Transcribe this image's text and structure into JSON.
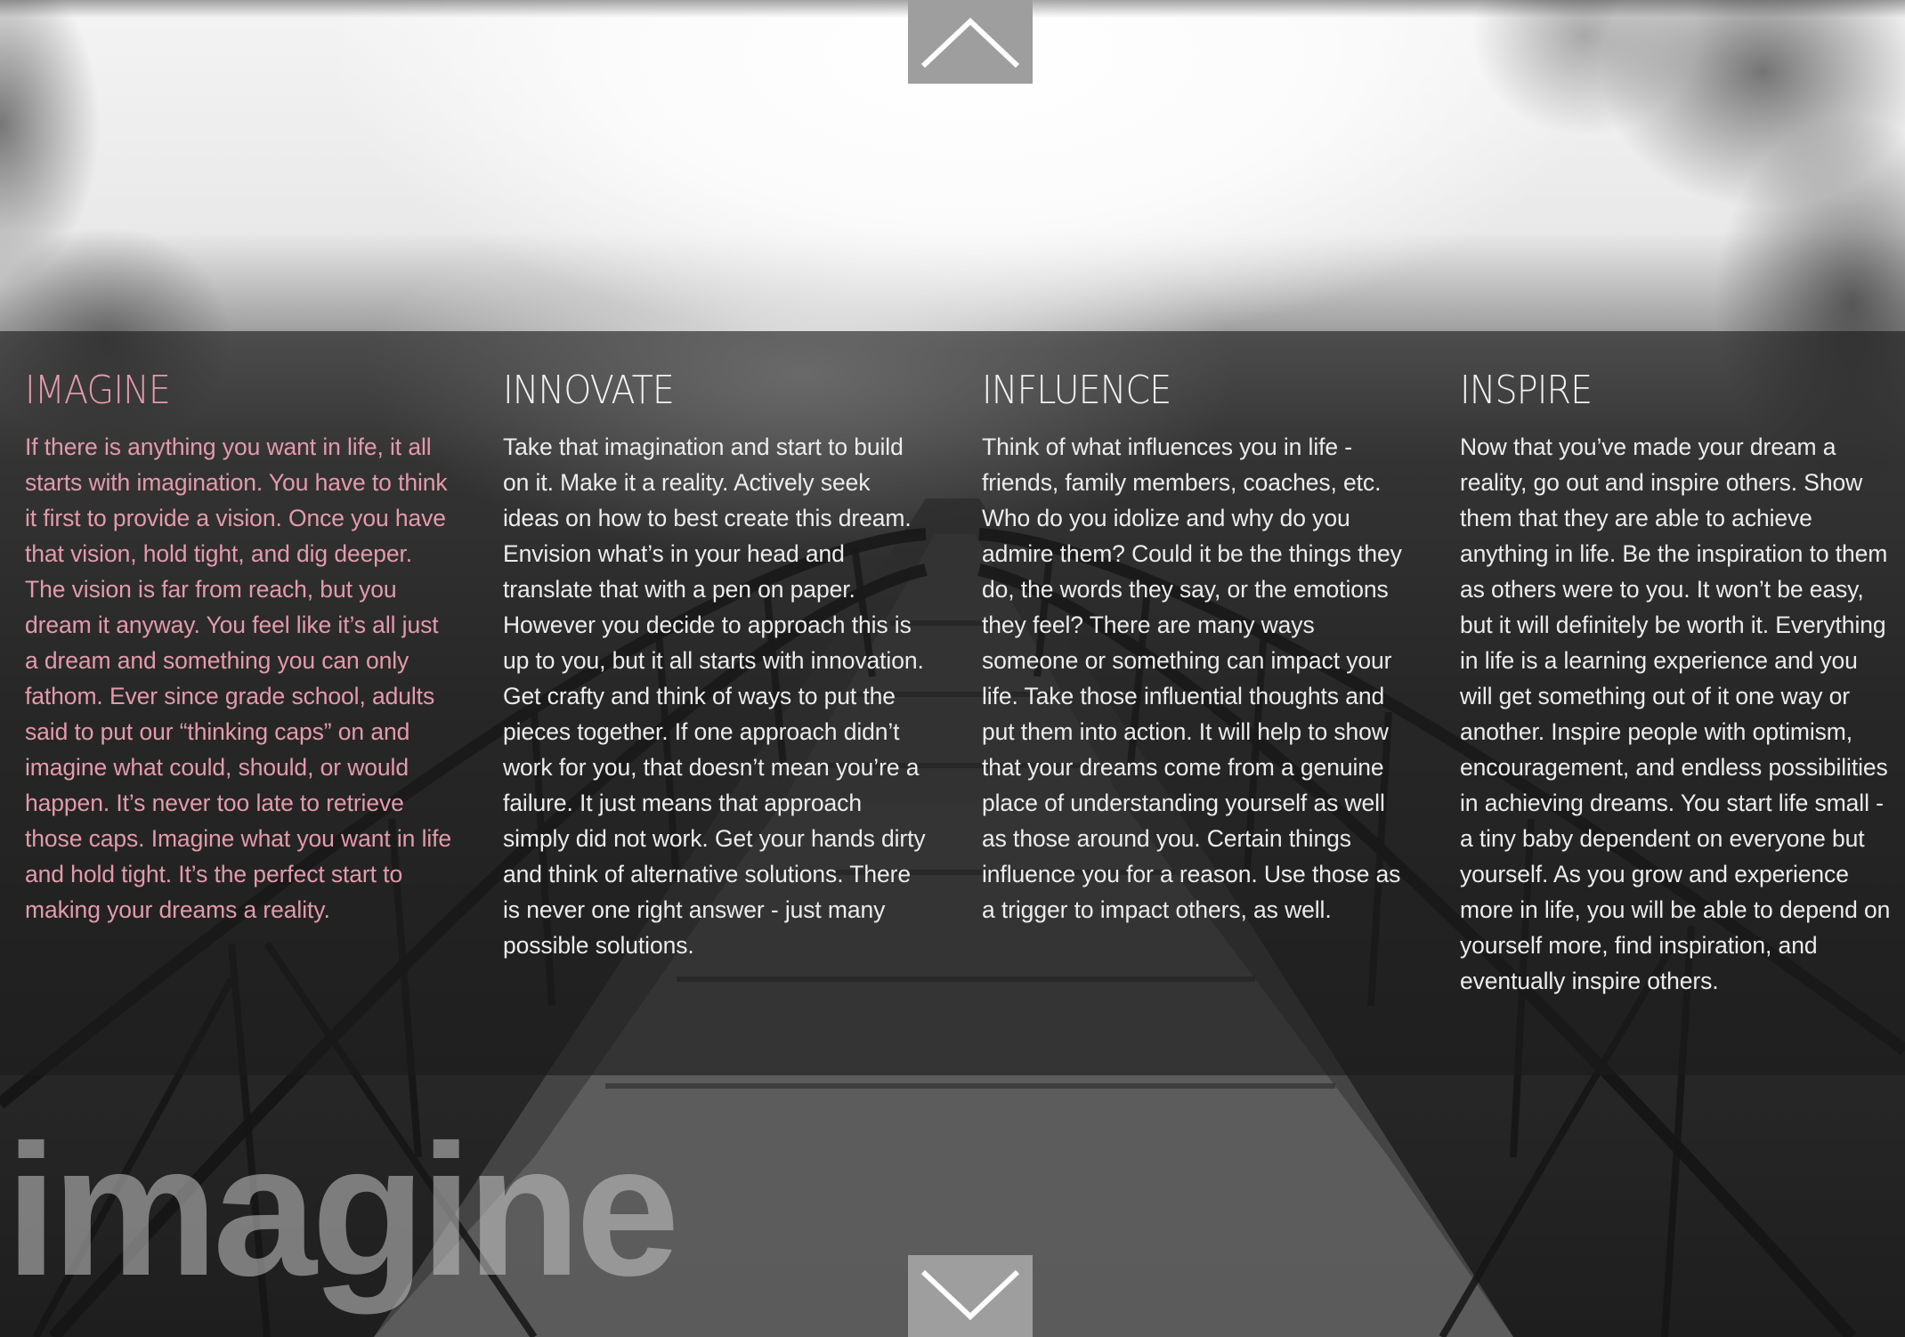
{
  "sections": [
    {
      "heading": "IMAGINE",
      "body": "If there is anything you want in life, it all starts with imagination. You have to think it first to provide a vision. Once you have that vision, hold tight, and dig deeper. The vision is far from reach, but you dream it anyway. You feel like it’s all just a dream and something you can only fathom. Ever since grade school, adults said to put our “thinking caps” on and imagine what could, should, or would happen. It’s never too late to retrieve those caps. Imagine what you want in life and hold tight. It’s the perfect start to making your dreams a reality.",
      "color": "#e49aac"
    },
    {
      "heading": "INNOVATE",
      "body": "Take that imagination and start to build on it. Make it a reality. Actively seek ideas on how to best create this dream. Envision what’s in your head and translate that with a pen on paper. However you decide to approach this is up to you, but it all starts with innovation. Get crafty and think of ways to put the pieces together. If one approach didn’t work for you, that doesn’t mean you’re a failure. It just means that approach simply did not work. Get your hands dirty and think of alternative solutions. There is never one right answer - just many possible solutions."
    },
    {
      "heading": "INFLUENCE",
      "body": "Think of what influences you in life - friends, family members, coaches, etc. Who do you idolize and why do you admire them? Could it be the things they do, the words they say, or the emotions they feel? There are many ways someone or something can impact your life. Take those influential thoughts and put them into action. It will help to show that your dreams come from a genuine place of understanding yourself as well as those around you. Certain things influence you for a reason. Use those as a trigger to impact others, as well."
    },
    {
      "heading": "INSPIRE",
      "body": "Now that you’ve made your dream a reality, go out and inspire others. Show them that they are able to achieve anything in life. Be the inspiration to them as others were to you. It won’t be easy, but it will definitely be worth it. Everything in life is a learning experience and you will get something out of it one way or another. Inspire people with optimism, encouragement, and endless possibilities in achieving dreams. You start life small - a tiny baby dependent on everyone but yourself. As you grow and experience more in life, you will be able to depend on yourself more, find inspiration, and eventually inspire others."
    }
  ],
  "watermark": "imagine",
  "nav": {
    "up_icon": "chevron-up-icon",
    "down_icon": "chevron-down-icon"
  },
  "colors": {
    "accent": "#e49aac",
    "panel": "#1c1c1c",
    "arrow_bg": "#9e9e9e",
    "text": "#ececec"
  }
}
